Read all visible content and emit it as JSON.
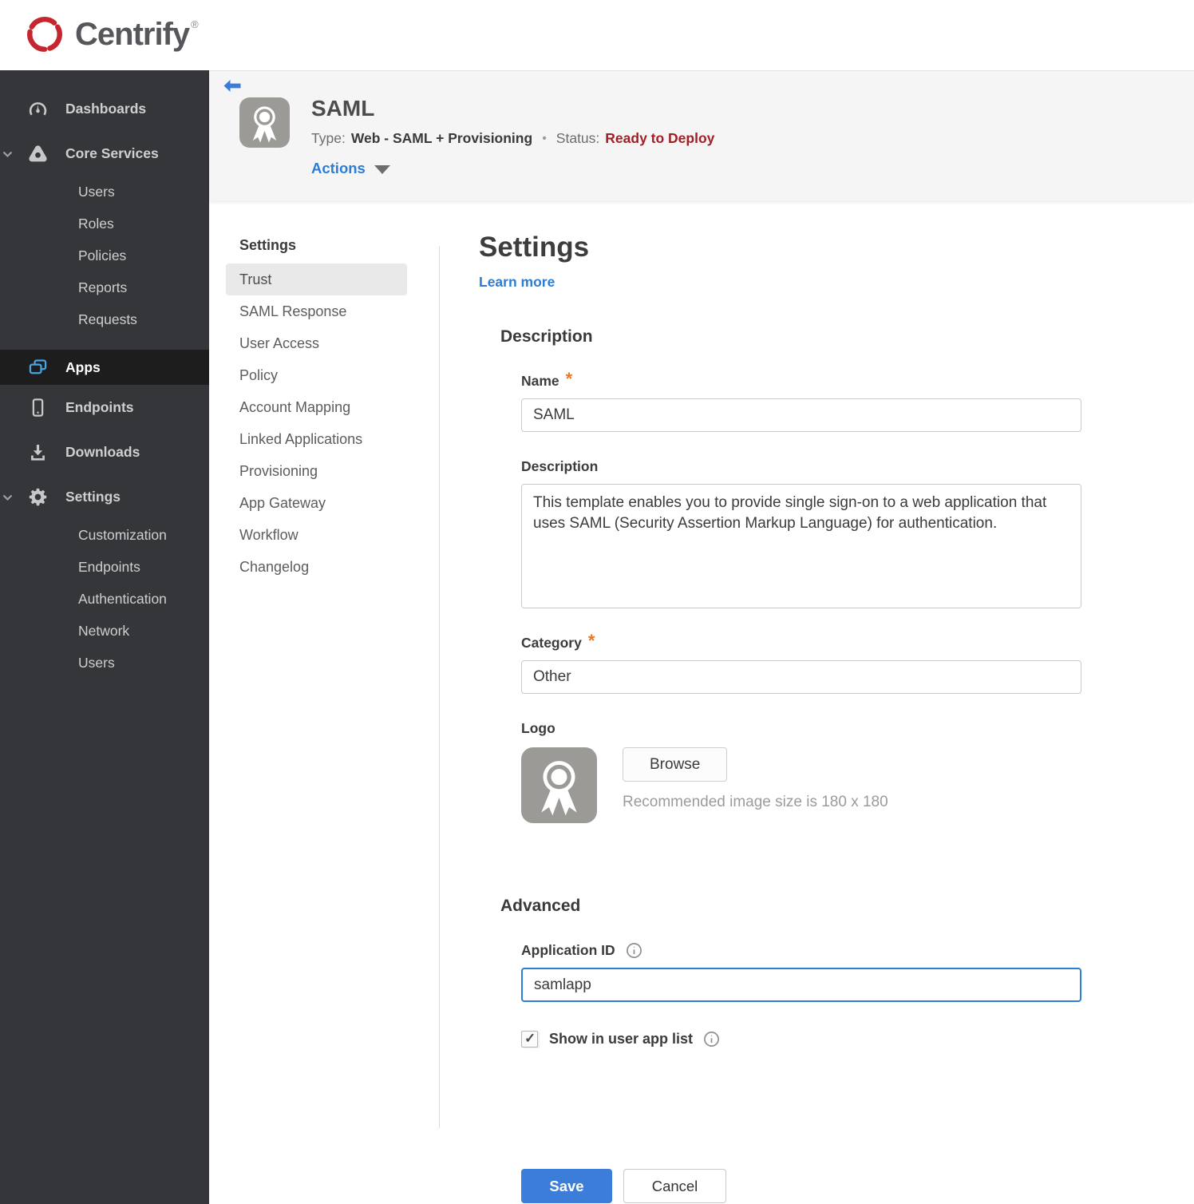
{
  "brand": {
    "name": "Centrify",
    "reg_mark": "®",
    "swirl_color": "#c4272e"
  },
  "colors": {
    "accent_blue": "#2d7cd4",
    "save_button": "#3b7dd8",
    "status_red": "#a02025",
    "sidebar_bg": "#343639",
    "sidebar_active_bg": "#1d1d1d",
    "header_band_bg": "#f5f5f6",
    "required_orange": "#ee7623"
  },
  "sidebar": {
    "items": [
      {
        "label": "Dashboards",
        "icon": "gauge-icon"
      },
      {
        "label": "Core Services",
        "icon": "core-services-icon",
        "expanded": true,
        "children": [
          "Users",
          "Roles",
          "Policies",
          "Reports",
          "Requests"
        ]
      },
      {
        "label": "Apps",
        "icon": "apps-icon",
        "active": true
      },
      {
        "label": "Endpoints",
        "icon": "mobile-device-icon"
      },
      {
        "label": "Downloads",
        "icon": "download-icon"
      },
      {
        "label": "Settings",
        "icon": "gear-icon",
        "expanded": true,
        "children": [
          "Customization",
          "Endpoints",
          "Authentication",
          "Network",
          "Users"
        ]
      }
    ]
  },
  "app_header": {
    "title": "SAML",
    "type_label": "Type:",
    "type_value": "Web - SAML + Provisioning",
    "separator": "•",
    "status_label": "Status:",
    "status_value": "Ready to Deploy",
    "actions_label": "Actions",
    "app_icon": "ribbon-award-icon",
    "back_icon": "back-arrow-icon"
  },
  "subnav": {
    "heading": "Settings",
    "active_item": "Trust",
    "items": [
      "Trust",
      "SAML Response",
      "User Access",
      "Policy",
      "Account Mapping",
      "Linked Applications",
      "Provisioning",
      "App Gateway",
      "Workflow",
      "Changelog"
    ]
  },
  "main": {
    "title": "Settings",
    "learn_more": "Learn more",
    "description_section": {
      "heading": "Description",
      "name_label": "Name",
      "name_required": "*",
      "name_value": "SAML",
      "description_label": "Description",
      "description_value": "This template enables you to provide single sign-on to a web application that uses SAML (Security Assertion Markup Language) for authentication.",
      "category_label": "Category",
      "category_required": "*",
      "category_value": "Other",
      "logo_label": "Logo",
      "logo_icon": "ribbon-award-icon",
      "browse_label": "Browse",
      "logo_hint": "Recommended image size is 180 x 180"
    },
    "advanced_section": {
      "heading": "Advanced",
      "app_id_label": "Application ID",
      "app_id_value": "samlapp",
      "show_in_app_list_label": "Show in user app list",
      "show_in_app_list_checked": true
    },
    "save_label": "Save",
    "cancel_label": "Cancel"
  }
}
